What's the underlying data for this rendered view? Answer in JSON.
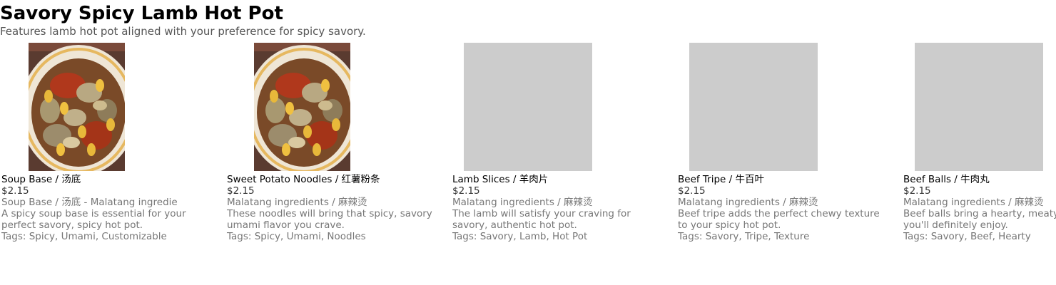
{
  "header": {
    "title": "Savory Spicy Lamb Hot Pot",
    "subtitle": "Features lamb hot pot aligned with your preference for spicy savory."
  },
  "items": [
    {
      "name": "Soup Base / 汤底",
      "price": "$2.15",
      "category": "Soup Base / 汤底  - Malatang ingredie",
      "description": "A spicy soup base is essential for your perfect savory, spicy hot pot.",
      "tags": "Tags: Spicy, Umami, Customizable",
      "image": "photo"
    },
    {
      "name": "Sweet Potato Noodles / 红薯粉条",
      "price": "$2.15",
      "category": "Malatang ingredients / 麻辣烫",
      "description": "These noodles will bring that spicy, savory umami flavor you crave.",
      "tags": "Tags: Spicy, Umami, Noodles",
      "image": "photo"
    },
    {
      "name": "Lamb Slices / 羊肉片",
      "price": "$2.15",
      "category": "Malatang ingredients / 麻辣烫",
      "description": "The lamb will satisfy your craving for savory, authentic hot pot.",
      "tags": "Tags: Savory, Lamb, Hot Pot",
      "image": "placeholder"
    },
    {
      "name": "Beef Tripe / 牛百叶",
      "price": "$2.15",
      "category": "Malatang ingredients / 麻辣烫",
      "description": "Beef tripe adds the perfect chewy texture to your spicy hot pot.",
      "tags": "Tags: Savory, Tripe, Texture",
      "image": "placeholder"
    },
    {
      "name": "Beef Balls / 牛肉丸",
      "price": "$2.15",
      "category": "Malatang ingredients / 麻辣烫",
      "description": "Beef balls bring a hearty, meaty flavor that you'll definitely enjoy.",
      "tags": "Tags: Savory, Beef, Hearty",
      "image": "placeholder"
    }
  ]
}
